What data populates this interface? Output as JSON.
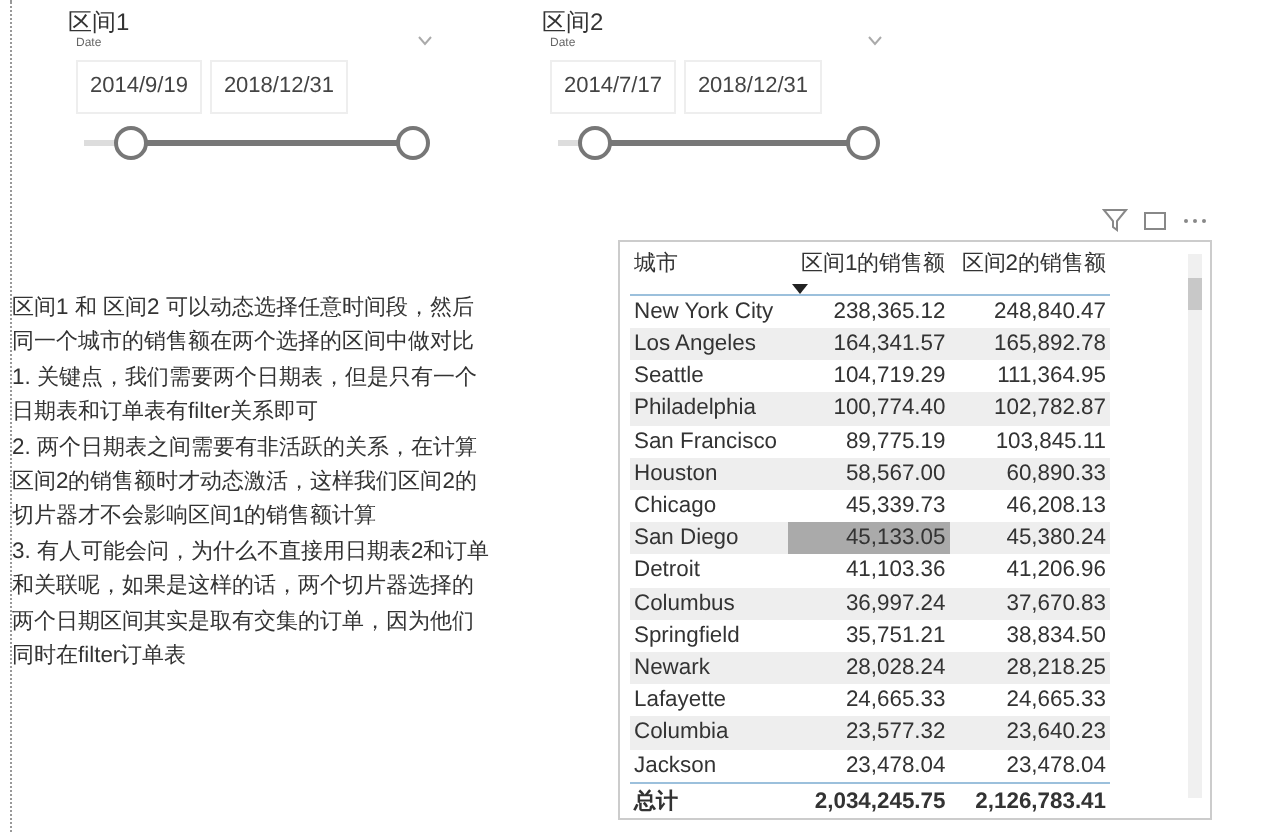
{
  "slicers": [
    {
      "title": "区间1",
      "field": "Date",
      "start": "2014/9/19",
      "end": "2018/12/31",
      "handles": [
        {
          "level": 0.14
        },
        {
          "level": 1
        }
      ]
    },
    {
      "title": "区间2",
      "field": "Date",
      "start": "2014/7/17",
      "end": "2018/12/31",
      "handles": [
        {
          "level": 0.12
        },
        {
          "level": 1
        }
      ]
    }
  ],
  "notes": [
    "区间1 和 区间2 可以动态选择任意时间段，然后同一个城市的销售额在两个选择的区间中做对比",
    "1. 关键点，我们需要两个日期表，但是只有一个日期表和订单表有filter关系即可",
    "2. 两个日期表之间需要有非活跃的关系，在计算区间2的销售额时才动态激活，这样我们区间2的切片器才不会影响区间1的销售额计算",
    "3. 有人可能会问，为什么不直接用日期表2和订单和关联呢，如果是这样的话，两个切片器选择的两个日期区间其实是取有交集的订单，因为他们同时在filter订单表"
  ],
  "table": {
    "columns": [
      {
        "label": "城市",
        "sorted": false
      },
      {
        "label": "区间1的销售额",
        "sorted": true
      },
      {
        "label": "区间2的销售额",
        "sorted": false
      }
    ],
    "rows": [
      {
        "cells": [
          "New York City",
          "238,365.12",
          "248,840.47"
        ],
        "selected": false
      },
      {
        "cells": [
          "Los Angeles",
          "164,341.57",
          "165,892.78"
        ],
        "selected": false
      },
      {
        "cells": [
          "Seattle",
          "104,719.29",
          "111,364.95"
        ],
        "selected": false
      },
      {
        "cells": [
          "Philadelphia",
          "100,774.40",
          "102,782.87"
        ],
        "selected": false
      },
      {
        "cells": [
          "San Francisco",
          "89,775.19",
          "103,845.11"
        ],
        "selected": false
      },
      {
        "cells": [
          "Houston",
          "58,567.00",
          "60,890.33"
        ],
        "selected": false
      },
      {
        "cells": [
          "Chicago",
          "45,339.73",
          "46,208.13"
        ],
        "selected": false
      },
      {
        "cells": [
          "San Diego",
          "45,133.05",
          "45,380.24"
        ],
        "selected": true
      },
      {
        "cells": [
          "Detroit",
          "41,103.36",
          "41,206.96"
        ],
        "selected": false
      },
      {
        "cells": [
          "Columbus",
          "36,997.24",
          "37,670.83"
        ],
        "selected": false
      },
      {
        "cells": [
          "Springfield",
          "35,751.21",
          "38,834.50"
        ],
        "selected": false
      },
      {
        "cells": [
          "Newark",
          "28,028.24",
          "28,218.25"
        ],
        "selected": false
      },
      {
        "cells": [
          "Lafayette",
          "24,665.33",
          "24,665.33"
        ],
        "selected": false
      },
      {
        "cells": [
          "Columbia",
          "23,577.32",
          "23,640.23"
        ],
        "selected": false
      },
      {
        "cells": [
          "Jackson",
          "23,478.04",
          "23,478.04"
        ],
        "selected": false
      }
    ],
    "total": [
      "总计",
      "2,034,245.75",
      "2,126,783.41"
    ]
  }
}
